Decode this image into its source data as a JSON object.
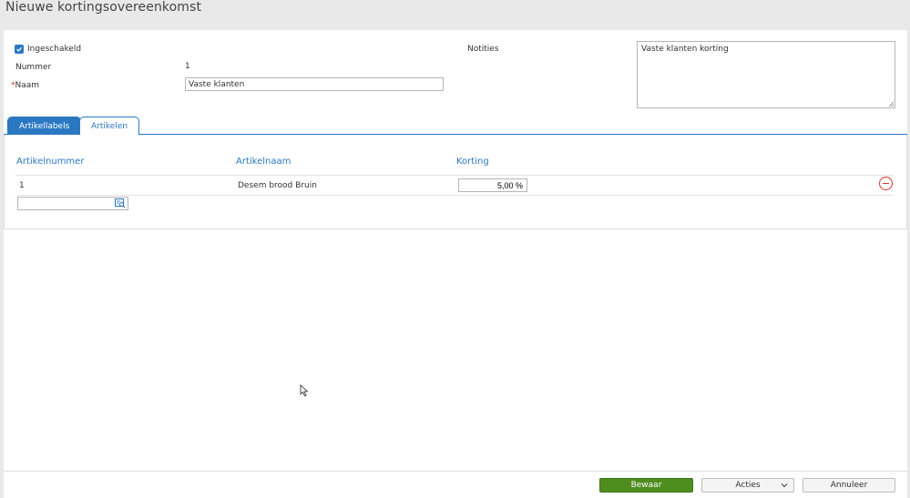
{
  "page": {
    "title": "Nieuwe kortingsovereenkomst"
  },
  "form": {
    "enabled_label": "Ingeschakeld",
    "enabled_checked": true,
    "number_label": "Nummer",
    "number_value": "1",
    "name_required_mark": "*",
    "name_label": "Naam",
    "name_value": "Vaste klanten",
    "notes_label": "Notities",
    "notes_value": "Vaste klanten korting"
  },
  "tabs": [
    {
      "label": "Artikellabels",
      "active": true
    },
    {
      "label": "Artikelen",
      "active": false
    }
  ],
  "table": {
    "headers": [
      "Artikelnummer",
      "Artikelnaam",
      "Korting"
    ],
    "rows": [
      {
        "number": "1",
        "name": "Desem brood Bruin",
        "discount": "5,00 %"
      }
    ]
  },
  "footer": {
    "save_label": "Bewaar",
    "actions_label": "Acties",
    "cancel_label": "Annuleer"
  },
  "colors": {
    "accent": "#2a78c2",
    "save_button": "#4f8d1e",
    "remove": "#d9342b"
  }
}
